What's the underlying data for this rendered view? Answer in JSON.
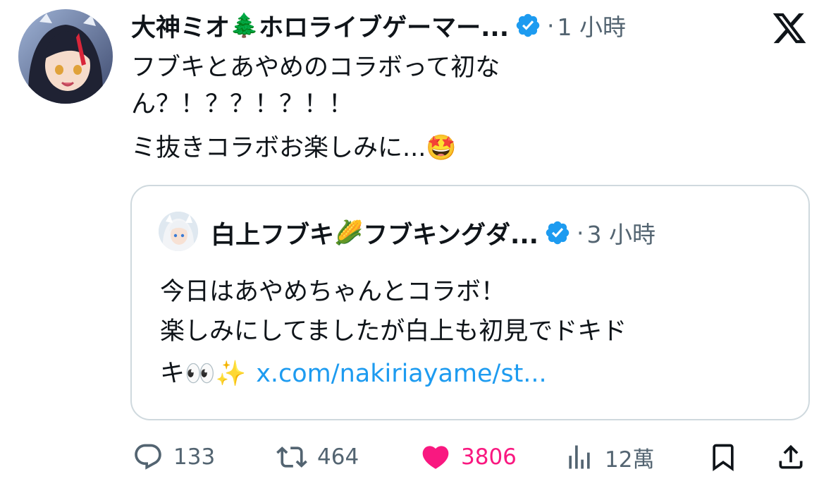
{
  "tweet": {
    "display_name": "大神ミオ",
    "name_emoji": "🌲",
    "name_suffix": "ホロライブゲーマー...",
    "separator": "·",
    "time": "1 小時",
    "body_lines": [
      "フブキとあやめのコラボって初な",
      "ん？！？？！？！！",
      "ミ抜きコラボお楽しみに..."
    ],
    "body_emoji": "🤩"
  },
  "quote": {
    "display_name": "白上フブキ",
    "name_emoji": "🌽",
    "name_suffix": "フブキングダ...",
    "separator": "·",
    "time": "3 小時",
    "body_lines": [
      "今日はあやめちゃんとコラボ！",
      "楽しみにしてましたが白上も初見でドキド"
    ],
    "last_line_prefix": "キ",
    "last_line_emoji": "👀✨",
    "link_text": "x.com/nakiriayame/st..."
  },
  "actions": {
    "reply_count": "133",
    "repost_count": "464",
    "like_count": "3806",
    "views_count": "12萬"
  },
  "colors": {
    "accent": "#1d9bf0",
    "like": "#f91880",
    "muted": "#536471",
    "border": "#cfd9de"
  },
  "icons": [
    "x-logo-icon",
    "verified-badge-icon",
    "reply-icon",
    "repost-icon",
    "like-icon",
    "views-icon",
    "bookmark-icon",
    "share-icon"
  ]
}
